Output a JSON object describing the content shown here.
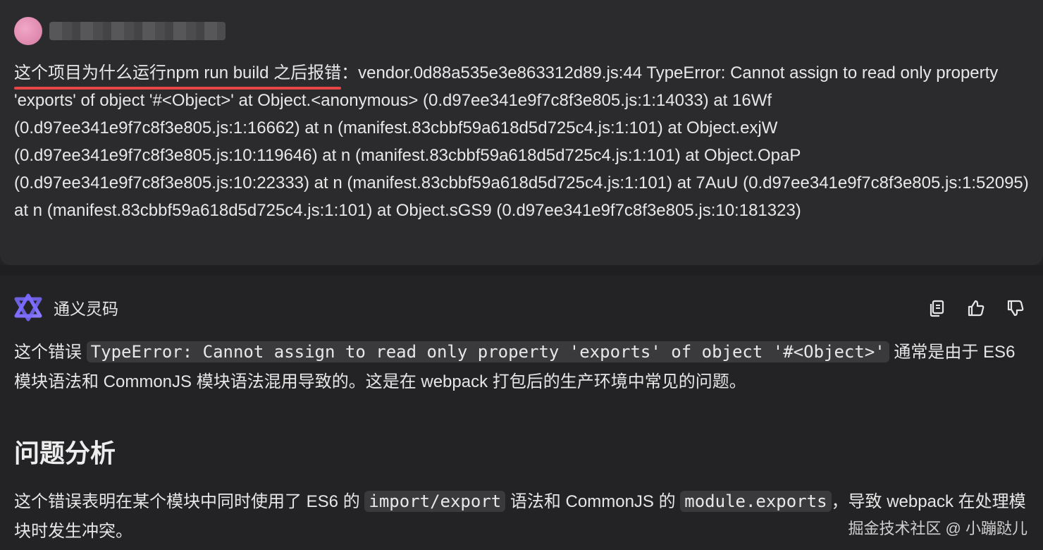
{
  "user": {
    "avatar_icon": "avatar-icon",
    "question_lead": "这个项目为什么运行npm run build 之后报错",
    "question_rest": "：vendor.0d88a535e3e863312d89.js:44 TypeError: Cannot assign to read only property 'exports' of object '#<Object>' at Object.<anonymous> (0.d97ee341e9f7c8f3e805.js:1:14033) at 16Wf (0.d97ee341e9f7c8f3e805.js:1:16662) at n (manifest.83cbbf59a618d5d725c4.js:1:101) at Object.exjW (0.d97ee341e9f7c8f3e805.js:10:119646) at n (manifest.83cbbf59a618d5d725c4.js:1:101) at Object.OpaP (0.d97ee341e9f7c8f3e805.js:10:22333) at n (manifest.83cbbf59a618d5d725c4.js:1:101) at 7AuU (0.d97ee341e9f7c8f3e805.js:1:52095) at n (manifest.83cbbf59a618d5d725c4.js:1:101) at Object.sGS9 (0.d97ee341e9f7c8f3e805.js:10:181323)"
  },
  "assistant": {
    "name": "通义灵码",
    "actions": [
      "copy-icon",
      "thumbs-up-icon",
      "thumbs-down-icon"
    ],
    "p1_a": "这个错误 ",
    "p1_code": "TypeError: Cannot assign to read only property 'exports' of object '#<Object>'",
    "p1_b": " 通常是由于 ES6 模块语法和 CommonJS 模块语法混用导致的。这是在 webpack 打包后的生产环境中常见的问题。",
    "heading": "问题分析",
    "p2_a": "这个错误表明在某个模块中同时使用了 ES6 的 ",
    "p2_code1": "import/export",
    "p2_b": " 语法和 CommonJS 的 ",
    "p2_code2": "module.exports",
    "p2_c": "，导致 webpack 在处理模块时发生冲突。"
  },
  "watermark": "掘金技术社区 @ 小蹦跶儿",
  "colors": {
    "background": "#232325",
    "user_block": "#2b2b2d",
    "underline": "#e64646",
    "code_bg": "#3a3a3c"
  }
}
